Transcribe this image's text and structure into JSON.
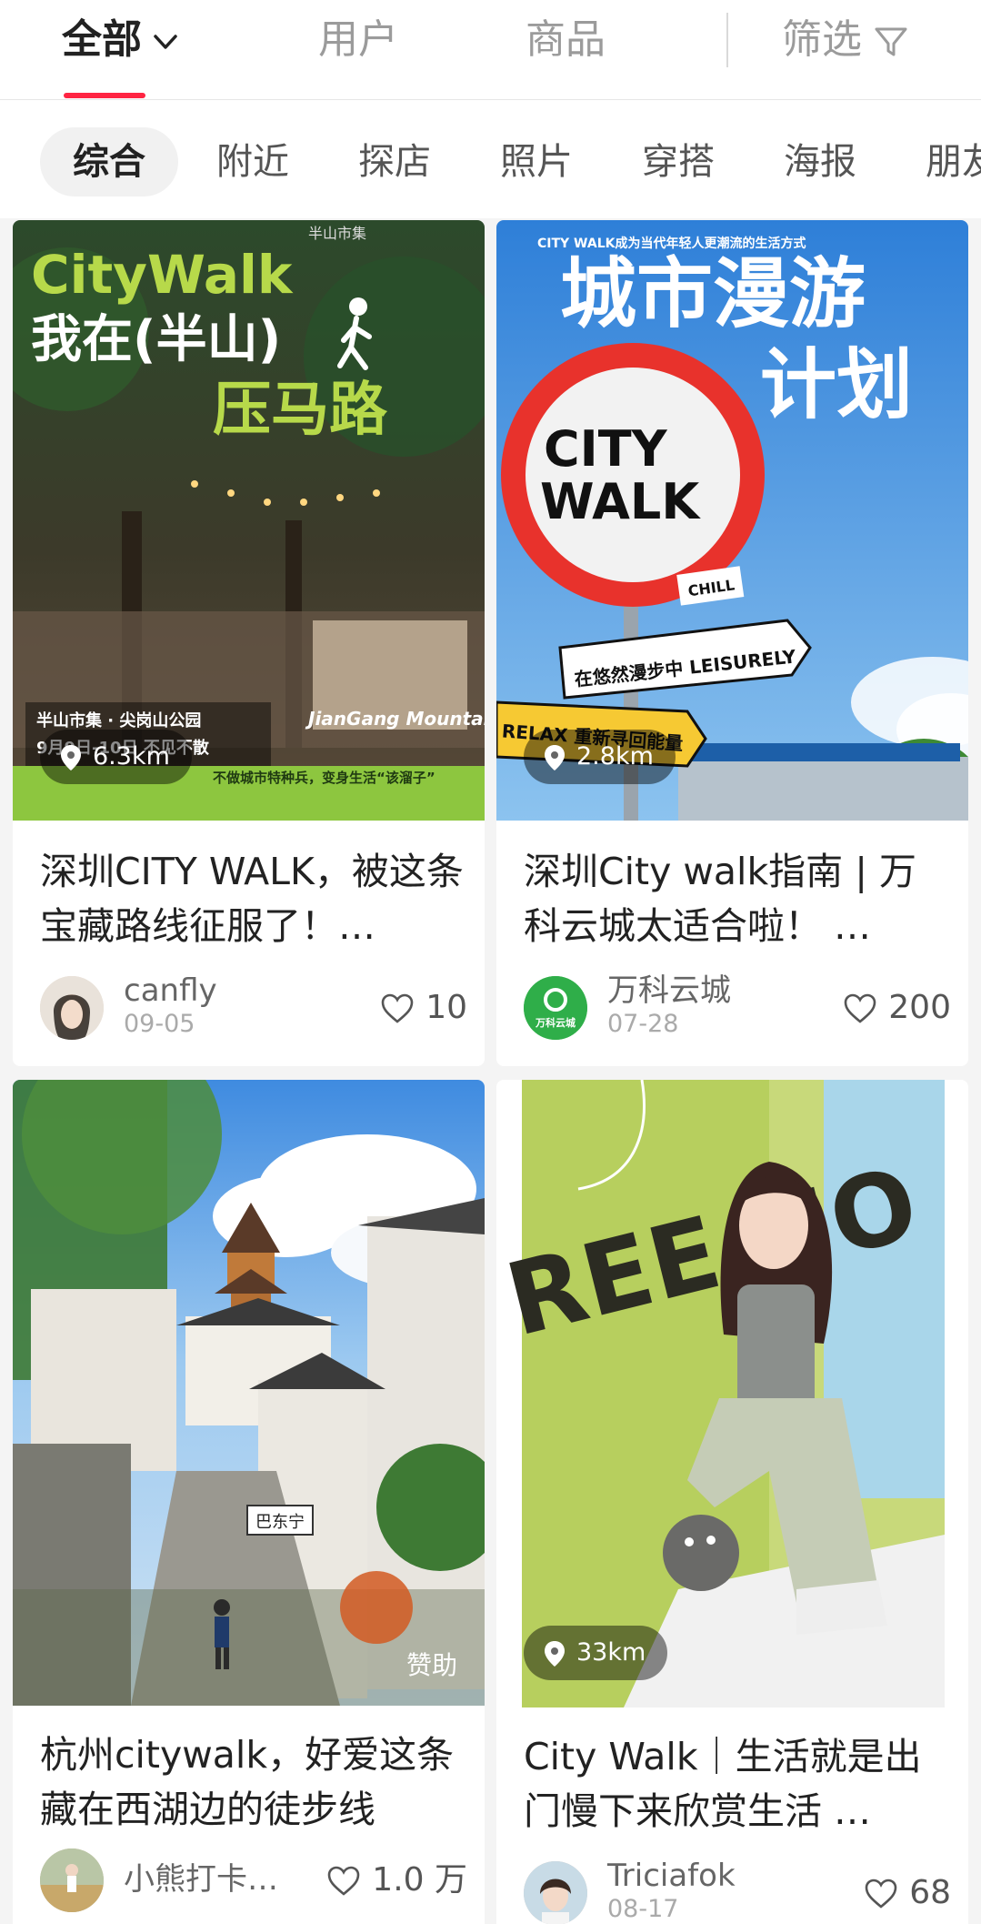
{
  "top_tabs": {
    "all": "全部",
    "users": "用户",
    "products": "商品",
    "filter": "筛选"
  },
  "sub_tabs": [
    "综合",
    "附近",
    "探店",
    "照片",
    "穿搭",
    "海报",
    "朋友"
  ],
  "cards": [
    {
      "distance": "6.3km",
      "img_text": {
        "brand": "半山市集",
        "logo": "CityWalk",
        "line1": "我在(半山)",
        "line2": "压马路",
        "info1": "半山市集 · 尖岗山公园",
        "info2": "9月9日-10日 不见不散",
        "footer": "不做城市特种兵，变身生活“该溜子”",
        "sign": "JianGang Mountain"
      },
      "title": "深圳CITY WALK，被这条宝藏路线征服了！…",
      "author": "canfly",
      "date": "09-05",
      "likes": "10"
    },
    {
      "distance": "2.8km",
      "img_text": {
        "top": "CITY WALK成为当代年轻人更潮流的生活方式",
        "line1": "城市漫游",
        "line2": "计划",
        "sign1": "CITY",
        "sign2": "WALK",
        "tag": "CHILL",
        "arrow1": "在悠然漫步中 LEISURELY",
        "arrow2": "RELAX 重新寻回能量"
      },
      "title": "深圳City walk指南 | 万科云城太适合啦！ …",
      "author": "万科云城",
      "avatar_text": "万科云城",
      "date": "07-28",
      "likes": "200"
    },
    {
      "sponsor": "赞助",
      "img_text": {
        "shop": "巴东宁"
      },
      "title": "杭州citywalk，好爱这条藏在西湖边的徒步线",
      "author": "小熊打卡…",
      "likes": "1.0 万"
    },
    {
      "distance": "33km",
      "img_text": {
        "wall": "REE HO"
      },
      "title": "City Walk｜生活就是出门慢下来欣赏生活 …",
      "author": "Triciafok",
      "date": "08-17",
      "likes": "68"
    }
  ],
  "colors": {
    "accent": "#ff2442",
    "poster_green": "#8dc63f",
    "sign_red": "#e8322c",
    "sky_blue": "#3a8be0"
  },
  "icons": [
    "chevron-down-icon",
    "filter-icon",
    "location-pin-icon",
    "heart-icon"
  ]
}
